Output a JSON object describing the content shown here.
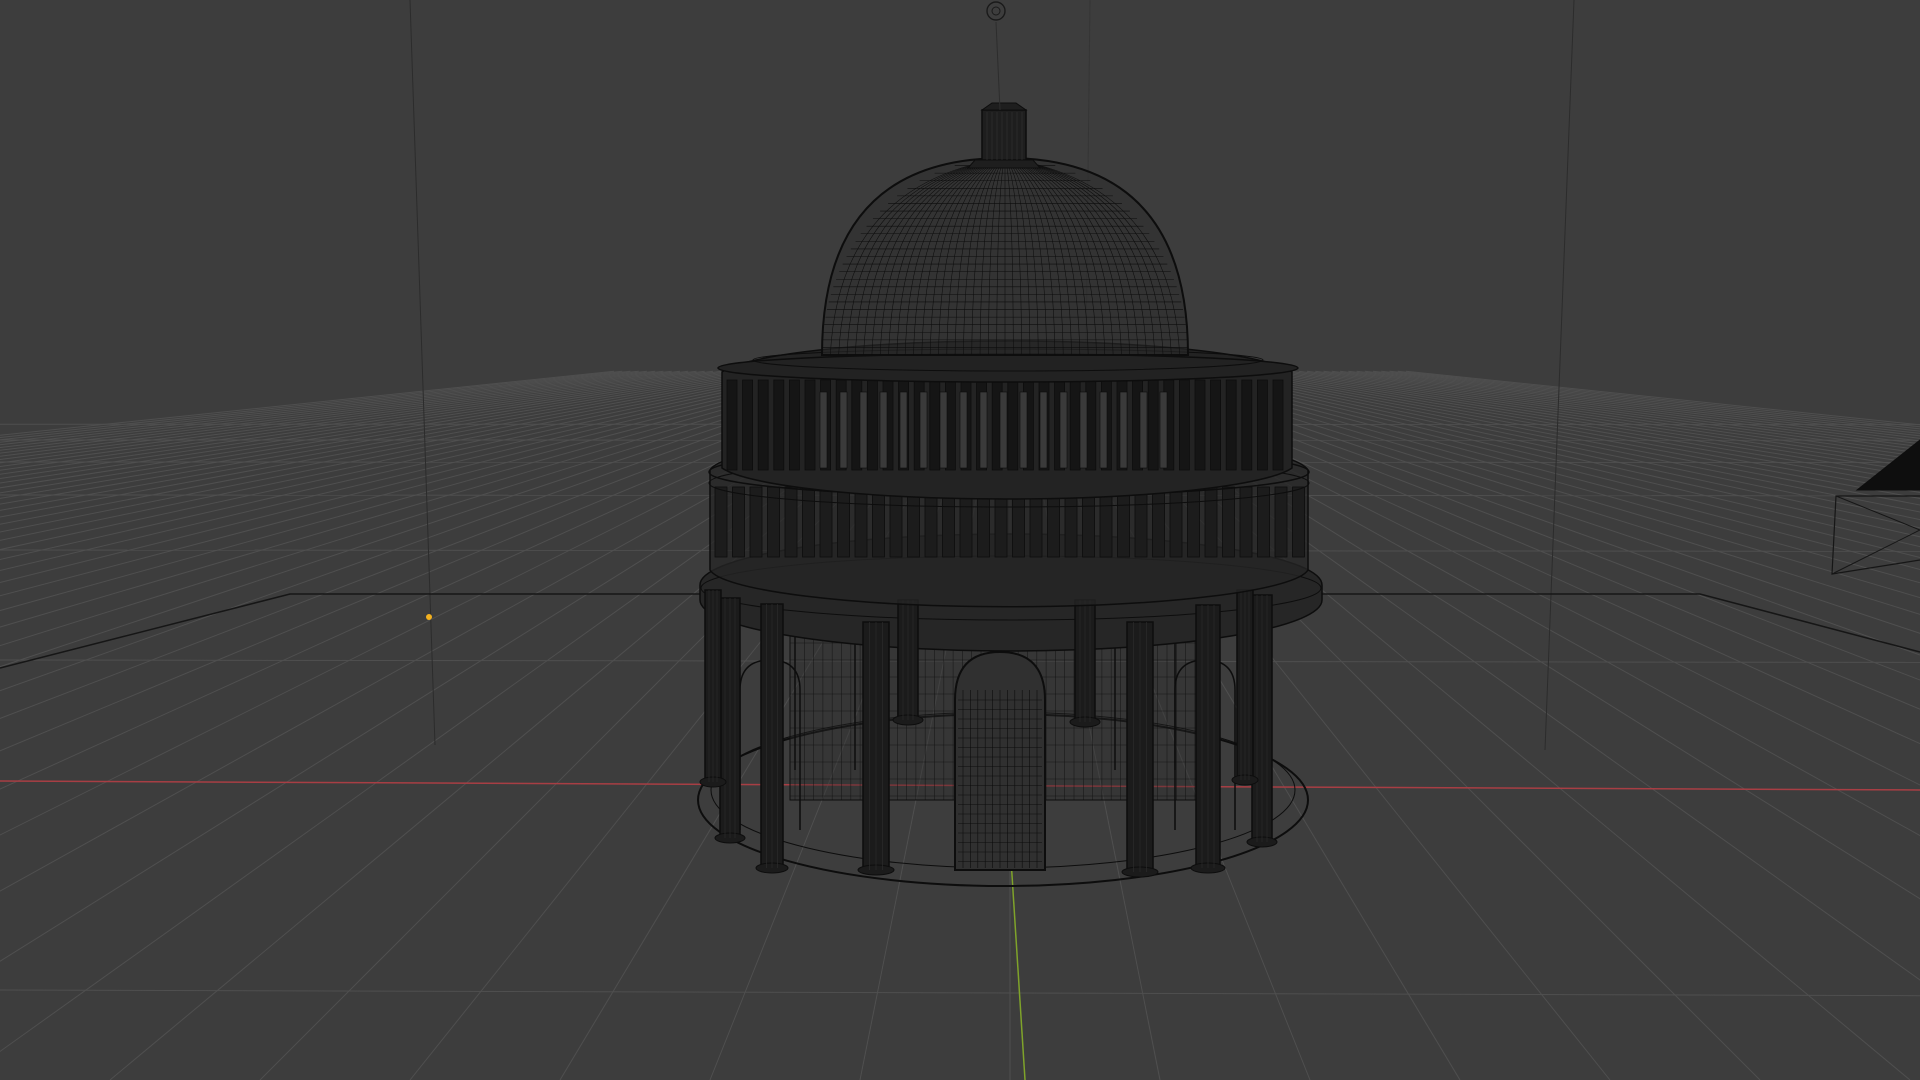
{
  "viewport": {
    "mode": "wireframe",
    "view": "perspective",
    "grid_visible": true,
    "background_color": "#3d3d3d",
    "grid_color": "#4f4f4f",
    "x_axis_color": "#a83e44",
    "y_axis_color": "#7fa32a",
    "wire_color": "#0d0d0d",
    "light_dot_color": "#f3b11f"
  },
  "scene": {
    "objects": [
      {
        "name": "rotunda",
        "icon": "dome-wireframe-icon"
      },
      {
        "name": "empty",
        "icon": "empty-icon"
      },
      {
        "name": "camera",
        "icon": "camera-icon"
      },
      {
        "name": "light",
        "icon": "point-light-icon"
      }
    ]
  }
}
